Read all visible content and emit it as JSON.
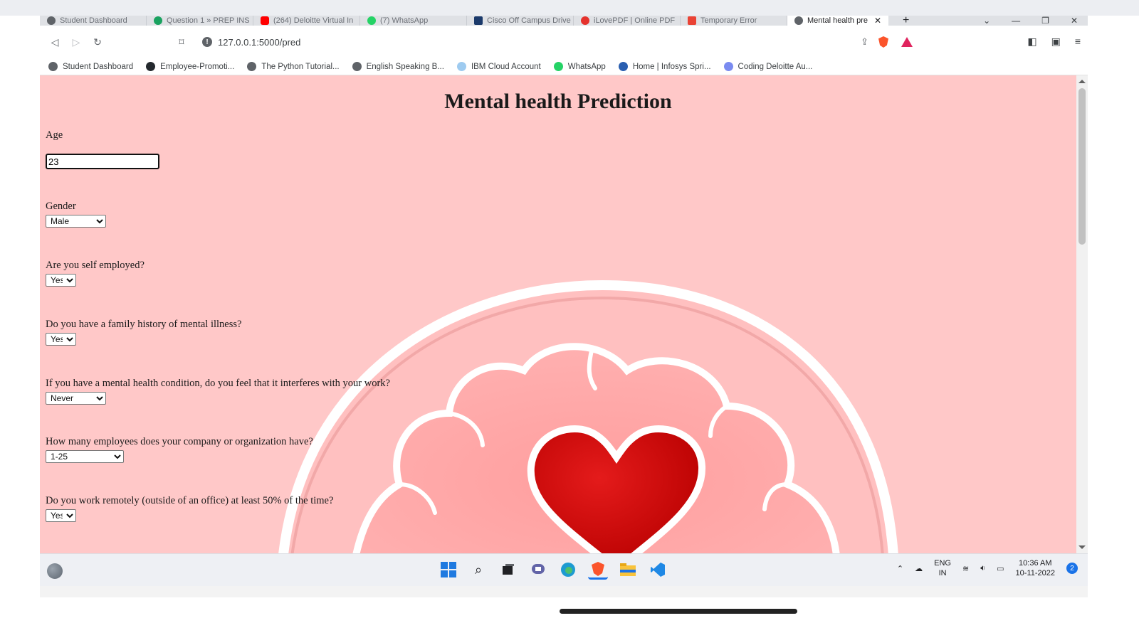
{
  "browser": {
    "tabs": [
      {
        "label": "Student Dashboard",
        "icon": "globe-icon",
        "color": "#5f6368"
      },
      {
        "label": "Question 1 » PREP INS",
        "icon": "prep-icon",
        "color": "#1aa260"
      },
      {
        "label": "(264) Deloitte Virtual In",
        "icon": "youtube-icon",
        "color": "#ff0000"
      },
      {
        "label": "(7) WhatsApp",
        "icon": "whatsapp-icon",
        "color": "#25d366"
      },
      {
        "label": "Cisco Off Campus Drive",
        "icon": "cisco-icon",
        "color": "#1b3a6b"
      },
      {
        "label": "iLovePDF | Online PDF",
        "icon": "ilovepdf-icon",
        "color": "#e5322d"
      },
      {
        "label": "Temporary Error",
        "icon": "gmail-icon",
        "color": "#ea4335"
      }
    ],
    "active_tab": {
      "label": "Mental health pre",
      "icon": "globe-icon"
    },
    "new_tab": "+",
    "url": "127.0.0.1:5000/pred",
    "bookmarks": [
      {
        "label": "Student Dashboard",
        "color": "#5f6368"
      },
      {
        "label": "Employee-Promoti...",
        "color": "#24292e"
      },
      {
        "label": "The Python Tutorial...",
        "color": "#5f6368"
      },
      {
        "label": "English Speaking B...",
        "color": "#5f6368"
      },
      {
        "label": "IBM Cloud Account",
        "color": "#9ecbf0"
      },
      {
        "label": "WhatsApp",
        "color": "#25d366"
      },
      {
        "label": "Home | Infosys Spri...",
        "color": "#2a5fb0"
      },
      {
        "label": "Coding Deloitte Au...",
        "color": "#7a8bf0"
      }
    ]
  },
  "page": {
    "title": "Mental health Prediction",
    "fields": [
      {
        "label": "Age",
        "type": "input",
        "value": "23"
      },
      {
        "label": "Gender",
        "type": "select",
        "value": "Male"
      },
      {
        "label": "Are you self employed?",
        "type": "select",
        "value": "Yes"
      },
      {
        "label": "Do you have a family history of mental illness?",
        "type": "select",
        "value": "Yes"
      },
      {
        "label": "If you have a mental health condition, do you feel that it interferes with your work?",
        "type": "select",
        "value": "Never"
      },
      {
        "label": "How many employees does your company or organization have?",
        "type": "select",
        "value": "1-25"
      },
      {
        "label": "Do you work remotely (outside of an office) at least 50% of the time?",
        "type": "select",
        "value": "Yes"
      }
    ],
    "background_color": "#ffc8c8"
  },
  "taskbar": {
    "language": "ENG",
    "region": "IN",
    "time": "10:36 AM",
    "date": "10-11-2022",
    "notifications": "2"
  }
}
